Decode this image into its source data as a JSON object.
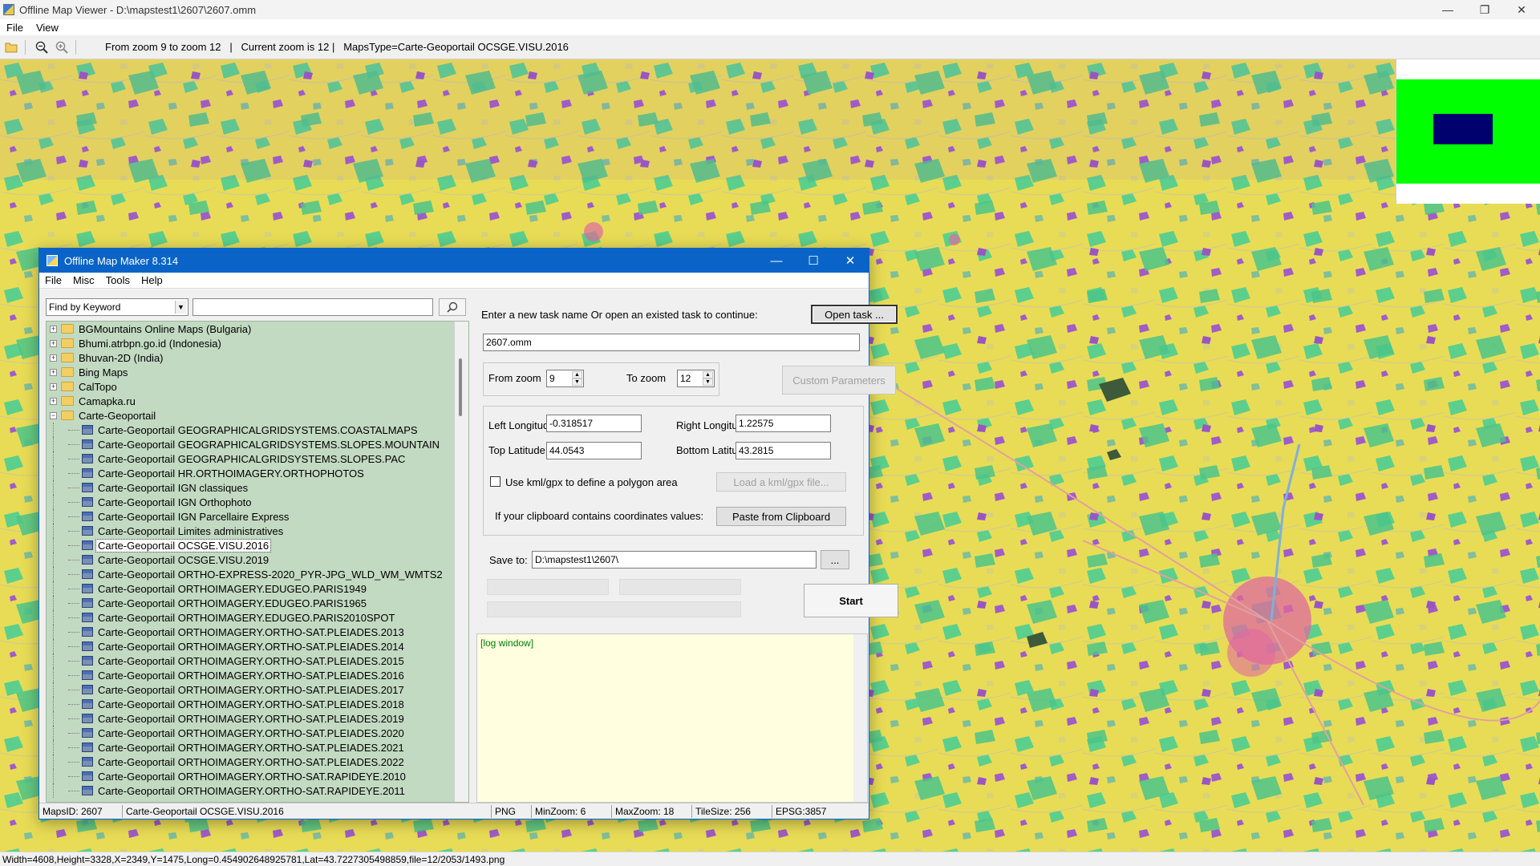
{
  "window": {
    "title": "Offline Map Viewer - D:\\mapstest1\\2607\\2607.omm",
    "controls": [
      "—",
      "❐",
      "✕"
    ]
  },
  "menu": [
    "File",
    "View"
  ],
  "toolbar": {
    "status": "From zoom 9 to zoom 12   |   Current zoom is 12 |   MapsType=Carte-Geoportail OCSGE.VISU.2016"
  },
  "bottom_status": "Width=4608,Height=3328,X=2349,Y=1475,Long=0.454902648925781,Lat=43.7227305498859,file=12/2053/1493.png",
  "colors": {
    "map_yellow": "#e8dc56",
    "map_green": "#5ccf8c",
    "map_purple": "#a05cc8",
    "map_pink": "#e06aa0",
    "overview_green": "#00ff00",
    "overview_box": "#00006e",
    "dialog_titlebar": "#0a64c8",
    "tree_bg": "#c3dac2",
    "log_bg": "#ffffe0"
  },
  "dialog": {
    "title": "Offline Map Maker 8.314",
    "controls": [
      "—",
      "☐",
      "✕"
    ],
    "menu": [
      "File",
      "Misc",
      "Tools",
      "Help"
    ],
    "find": {
      "mode": "Find by Keyword",
      "query": ""
    },
    "tree": {
      "groups": [
        {
          "label": "BGMountains Online Maps (Bulgaria)",
          "expanded": false
        },
        {
          "label": "Bhumi.atrbpn.go.id (Indonesia)",
          "expanded": false
        },
        {
          "label": "Bhuvan-2D (India)",
          "expanded": false
        },
        {
          "label": "Bing Maps",
          "expanded": false
        },
        {
          "label": "CalTopo",
          "expanded": false
        },
        {
          "label": "Camapka.ru",
          "expanded": false
        },
        {
          "label": "Carte-Geoportail",
          "expanded": true
        }
      ],
      "items": [
        "Carte-Geoportail GEOGRAPHICALGRIDSYSTEMS.COASTALMAPS",
        "Carte-Geoportail GEOGRAPHICALGRIDSYSTEMS.SLOPES.MOUNTAIN",
        "Carte-Geoportail GEOGRAPHICALGRIDSYSTEMS.SLOPES.PAC",
        "Carte-Geoportail HR.ORTHOIMAGERY.ORTHOPHOTOS",
        "Carte-Geoportail IGN classiques",
        "Carte-Geoportail IGN Orthophoto",
        "Carte-Geoportail IGN Parcellaire Express",
        "Carte-Geoportail Limites administratives",
        "Carte-Geoportail OCSGE.VISU.2016",
        "Carte-Geoportail OCSGE.VISU.2019",
        "Carte-Geoportail ORTHO-EXPRESS-2020_PYR-JPG_WLD_WM_WMTS2",
        "Carte-Geoportail ORTHOIMAGERY.EDUGEO.PARIS1949",
        "Carte-Geoportail ORTHOIMAGERY.EDUGEO.PARIS1965",
        "Carte-Geoportail ORTHOIMAGERY.EDUGEO.PARIS2010SPOT",
        "Carte-Geoportail ORTHOIMAGERY.ORTHO-SAT.PLEIADES.2013",
        "Carte-Geoportail ORTHOIMAGERY.ORTHO-SAT.PLEIADES.2014",
        "Carte-Geoportail ORTHOIMAGERY.ORTHO-SAT.PLEIADES.2015",
        "Carte-Geoportail ORTHOIMAGERY.ORTHO-SAT.PLEIADES.2016",
        "Carte-Geoportail ORTHOIMAGERY.ORTHO-SAT.PLEIADES.2017",
        "Carte-Geoportail ORTHOIMAGERY.ORTHO-SAT.PLEIADES.2018",
        "Carte-Geoportail ORTHOIMAGERY.ORTHO-SAT.PLEIADES.2019",
        "Carte-Geoportail ORTHOIMAGERY.ORTHO-SAT.PLEIADES.2020",
        "Carte-Geoportail ORTHOIMAGERY.ORTHO-SAT.PLEIADES.2021",
        "Carte-Geoportail ORTHOIMAGERY.ORTHO-SAT.PLEIADES.2022",
        "Carte-Geoportail ORTHOIMAGERY.ORTHO-SAT.RAPIDEYE.2010",
        "Carte-Geoportail ORTHOIMAGERY.ORTHO-SAT.RAPIDEYE.2011"
      ],
      "selected": "Carte-Geoportail OCSGE.VISU.2016"
    },
    "task_prompt": "Enter a new task name Or open an existed task to continue:",
    "open_task": "Open task ...",
    "task_name": "2607.omm",
    "from_zoom_label": "From zoom",
    "from_zoom": "9",
    "to_zoom_label": "To zoom",
    "to_zoom": "12",
    "custom_params": "Custom Parameters",
    "left_lon_label": "Left Longitude",
    "left_lon": "-0.318517",
    "right_lon_label": "Right Longitude",
    "right_lon": "1.22575",
    "top_lat_label": "Top Latitude",
    "top_lat": "44.0543",
    "bottom_lat_label": "Bottom Latitude",
    "bottom_lat": "43.2815",
    "kml_label": "Use kml/gpx to define a polygon area",
    "load_kml": "Load a kml/gpx file...",
    "clipboard_label": "If your clipboard contains coordinates values:",
    "paste_btn": "Paste from Clipboard",
    "save_label": "Save to:",
    "save_path": "D:\\mapstest1\\2607\\",
    "browse": "...",
    "start": "Start",
    "log": "[log window]",
    "status": {
      "maps_id": "MapsID: 2607",
      "map_name": "Carte-Geoportail OCSGE.VISU.2016",
      "format": "PNG",
      "min_zoom": "MinZoom: 6",
      "max_zoom": "MaxZoom: 18",
      "tile_size": "TileSize: 256",
      "epsg": "EPSG:3857"
    }
  }
}
